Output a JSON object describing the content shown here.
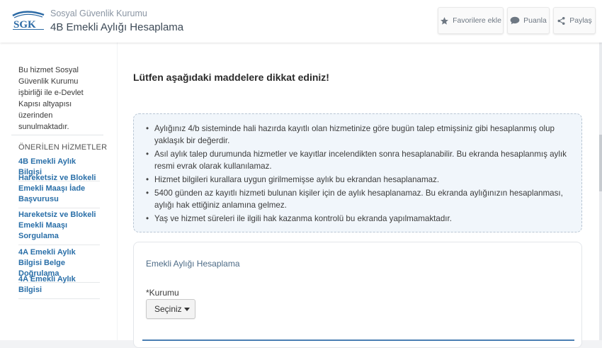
{
  "header": {
    "logo_text": "SGK",
    "org_name": "Sosyal Güvenlik Kurumu",
    "service_title": "4B Emekli Aylığı Hesaplama",
    "buttons": [
      {
        "label": "Favorilere ekle",
        "icon": "star-icon"
      },
      {
        "label": "Puanla",
        "icon": "speech-bubble-icon"
      },
      {
        "label": "Paylaş",
        "icon": "share-icon"
      }
    ]
  },
  "sidebar": {
    "info_text": "Bu hizmet Sosyal Güvenlik Kurumu işbirliği ile e-Devlet Kapısı altyapısı üzerinden sunulmaktadır.",
    "recommended_heading": "ÖNERİLEN HİZMETLER",
    "links": [
      "4B Emekli Aylık Bilgisi",
      "Hareketsiz ve Blokeli Emekli Maaşı İade Başvurusu",
      "Hareketsiz ve Blokeli Emekli Maaşı Sorgulama",
      "4A Emekli Aylık Bilgisi Belge Doğrulama",
      "4A Emekli Aylık Bilgisi"
    ]
  },
  "main": {
    "notice_heading": "Lütfen aşağıdaki maddelere dikkat ediniz!",
    "notices": [
      "Aylığınız 4/b sisteminde hali hazırda kayıtlı olan hizmetinize göre bugün talep etmişsiniz gibi hesaplanmış olup yaklaşık bir değerdir.",
      "Asıl aylık talep durumunda hizmetler ve kayıtlar incelendikten sonra hesaplanabilir. Bu ekranda hesaplanmış aylık resmi evrak olarak kullanılamaz.",
      "Hizmet bilgileri kurallara uygun girilmemişse aylık bu ekrandan hesaplanamaz.",
      "5400 günden az kayıtlı hizmeti bulunan kişiler için de aylık hesaplanamaz. Bu ekranda aylığınızın hesaplanması, aylığı hak ettiğiniz anlamına gelmez.",
      "Yaş ve hizmet süreleri ile ilgili hak kazanma kontrolü bu ekranda yapılmamaktadır."
    ],
    "form": {
      "title": "Emekli Aylığı Hesaplama",
      "kurum_label": "*Kurumu",
      "kurum_selected": "Seçiniz"
    }
  },
  "colors": {
    "link": "#2a6fa8",
    "notice_bg": "#f1f6fb",
    "accent_rule": "#4a7fb3"
  }
}
